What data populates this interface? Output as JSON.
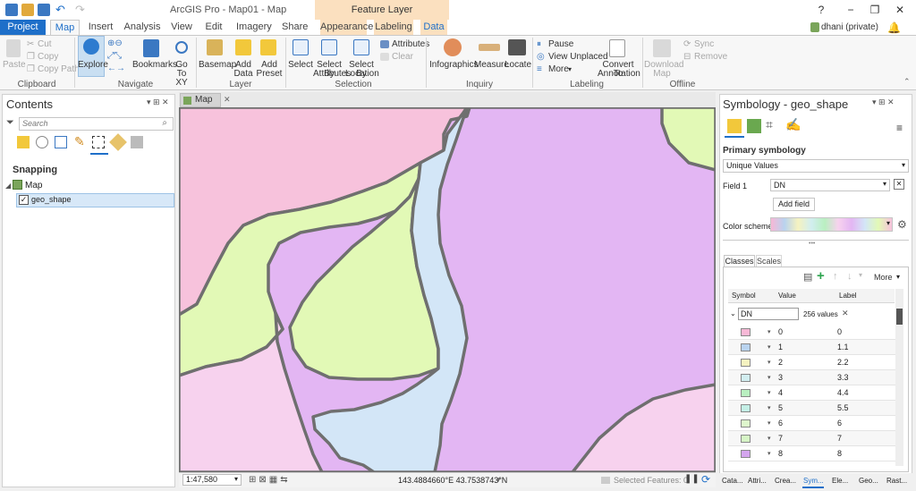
{
  "app": {
    "title": "ArcGIS Pro - Map01 - Map",
    "context_group": "Feature Layer",
    "help": "?",
    "user": "dhani (private)"
  },
  "tabs": [
    "Project",
    "Map",
    "Insert",
    "Analysis",
    "View",
    "Edit",
    "Imagery",
    "Share",
    "Appearance",
    "Labeling",
    "Data"
  ],
  "ribbon": {
    "clipboard": {
      "group": "Clipboard",
      "paste": "Paste",
      "cut": "Cut",
      "copy": "Copy",
      "copy_path": "Copy Path"
    },
    "navigate": {
      "group": "Navigate",
      "explore": "Explore",
      "bookmarks": "Bookmarks",
      "goto1": "Go",
      "goto2": "To XY"
    },
    "layer": {
      "group": "Layer",
      "basemap": "Basemap",
      "add_data1": "Add",
      "add_data2": "Data",
      "add_preset1": "Add",
      "add_preset2": "Preset"
    },
    "selection": {
      "group": "Selection",
      "select": "Select",
      "sba1": "Select By",
      "sba2": "Attributes",
      "sbl1": "Select By",
      "sbl2": "Location",
      "attributes": "Attributes",
      "clear": "Clear"
    },
    "inquiry": {
      "group": "Inquiry",
      "infographics": "Infographics",
      "measure": "Measure",
      "locate": "Locate"
    },
    "labeling": {
      "group": "Labeling",
      "pause": "Pause",
      "view_unplaced": "View Unplaced",
      "more": "More",
      "convert1": "Convert To",
      "convert2": "Annotation"
    },
    "offline": {
      "group": "Offline",
      "download1": "Download",
      "download2": "Map",
      "sync": "Sync",
      "remove": "Remove"
    }
  },
  "contents": {
    "title": "Contents",
    "search_placeholder": "Search",
    "section": "Snapping",
    "map_item": "Map",
    "layer_item": "geo_shape"
  },
  "map": {
    "tab": "Map",
    "scale": "1:47,580",
    "coords": "143.4884660°E 43.7538743°N",
    "selected": "Selected Features: 0"
  },
  "symbology": {
    "title": "Symbology - geo_shape",
    "primary": "Primary symbology",
    "method": "Unique Values",
    "field1_label": "Field 1",
    "field1_value": "DN",
    "add_field": "Add field",
    "color_scheme_label": "Color scheme",
    "subtabs": [
      "Classes",
      "Scales"
    ],
    "more": "More",
    "columns": [
      "Symbol",
      "Value",
      "Label"
    ],
    "group_field": "DN",
    "group_count": "256 values",
    "rows": [
      {
        "value": "0",
        "label": "0",
        "color": "#f7b8d6"
      },
      {
        "value": "1",
        "label": "1.1",
        "color": "#b9d3ef"
      },
      {
        "value": "2",
        "label": "2.2",
        "color": "#f5f2c0"
      },
      {
        "value": "3",
        "label": "3.3",
        "color": "#d2eef0"
      },
      {
        "value": "4",
        "label": "4.4",
        "color": "#b9efc0"
      },
      {
        "value": "5",
        "label": "5.5",
        "color": "#c4efe6"
      },
      {
        "value": "6",
        "label": "6",
        "color": "#def7cc"
      },
      {
        "value": "7",
        "label": "7",
        "color": "#d6f5c6"
      },
      {
        "value": "8",
        "label": "8",
        "color": "#d4a6ee"
      }
    ]
  },
  "bottom_tabs": [
    "Cata...",
    "Attri...",
    "Crea...",
    "Sym...",
    "Ele...",
    "Geo...",
    "Rast..."
  ],
  "map_colors": {
    "pink": "#f7c2dc",
    "purple": "#e3b6f3",
    "green": "#e2f9b6",
    "blue": "#d3e6f7",
    "light_pink": "#f7d2ee",
    "outline": "#6f6f6f"
  }
}
